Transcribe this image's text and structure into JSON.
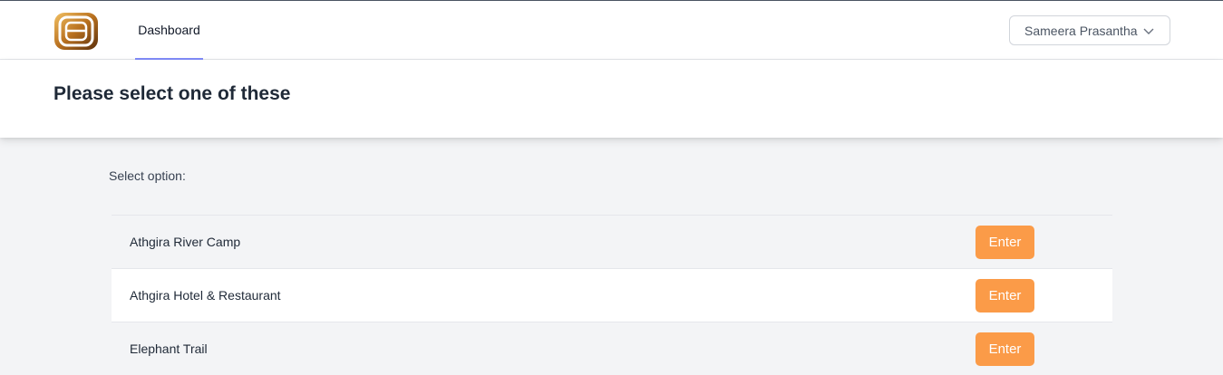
{
  "nav": {
    "dashboard_label": "Dashboard"
  },
  "user_menu": {
    "name": "Sameera Prasantha"
  },
  "header": {
    "title": "Please select one of these"
  },
  "main": {
    "select_label": "Select option:",
    "options": [
      {
        "name": "Athgira River Camp",
        "button_label": "Enter"
      },
      {
        "name": "Athgira Hotel & Restaurant",
        "button_label": "Enter"
      },
      {
        "name": "Elephant Trail",
        "button_label": "Enter"
      }
    ]
  },
  "colors": {
    "accent": "#fb9b48",
    "nav_underline": "#818cf8",
    "logo_gold": "#c98a2e"
  },
  "icons": {
    "logo": "brand-logo-icon",
    "user_menu": "chevron-down-icon"
  }
}
